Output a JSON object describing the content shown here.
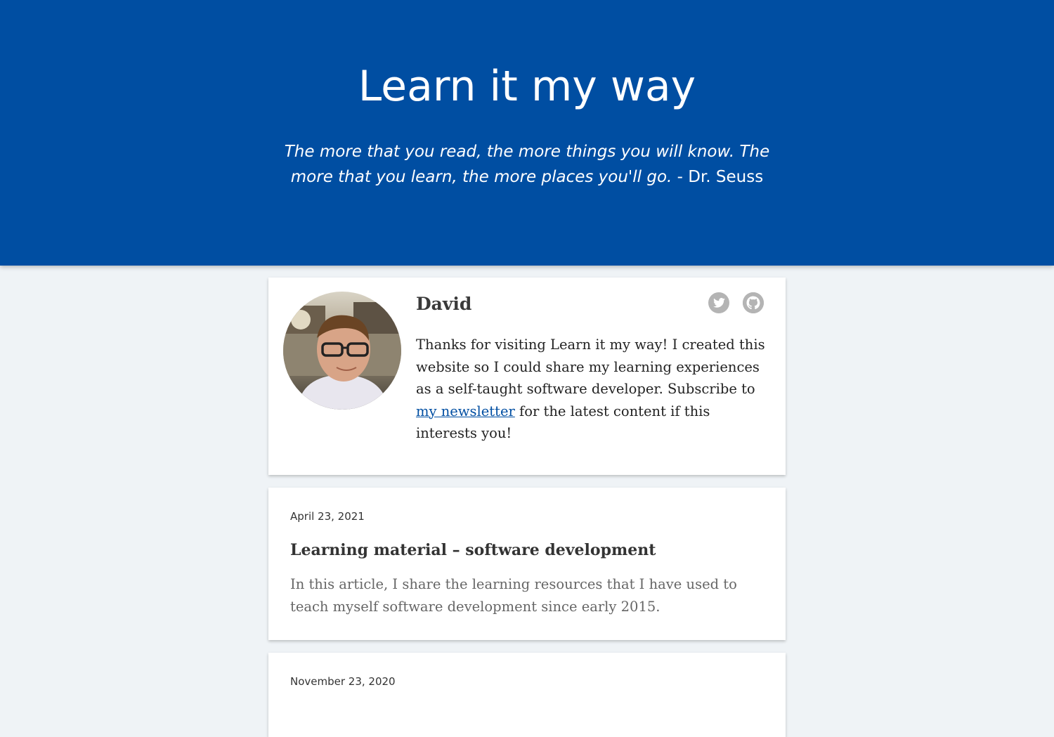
{
  "site": {
    "title": "Learn it my way",
    "quote_text": "The more that you read, the more things you will know. The more that you learn, the more places you'll go.",
    "quote_author": "- Dr. Seuss"
  },
  "author": {
    "name": "David",
    "bio_before": "Thanks for visiting Learn it my way! I created this website so I could share my learning experiences as a self-taught software developer. Subscribe to",
    "bio_link": "my newsletter",
    "bio_after": "for the latest content if this interests you!",
    "social_icons": [
      "twitter-icon",
      "github-icon"
    ]
  },
  "posts": [
    {
      "date": "April 23, 2021",
      "title": "Learning material – software development",
      "excerpt": "In this article, I share the learning resources that I have used to teach myself software development since early 2015."
    },
    {
      "date": "November 23, 2020"
    }
  ],
  "colors": {
    "hero_bg": "#004ea2",
    "page_bg": "#eff3f6",
    "link": "#004ea2",
    "icon": "#b4b4b4"
  }
}
